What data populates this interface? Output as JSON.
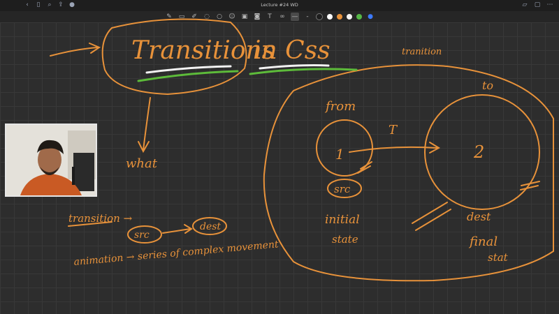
{
  "window": {
    "title": "Lecture #24 WD"
  },
  "toolbar": {
    "tools": [
      "pen-icon",
      "eraser-icon",
      "highlighter-icon",
      "lasso-icon",
      "shapes-icon",
      "sticker-icon",
      "image-icon",
      "camera-icon",
      "text-icon",
      "link-icon",
      "line-width-icon"
    ],
    "colors": [
      "#1e1e1e",
      "#ffffff",
      "#e8923a",
      "#ffffff",
      "#55b846"
    ],
    "accent": "#3d7bff"
  },
  "notes": {
    "heading_1": "Transitions",
    "heading_2": "in Css",
    "top_right": "tranition",
    "what": "what",
    "from": "from",
    "to": "to",
    "T": "T",
    "one": "1",
    "two": "2",
    "src_1": "src",
    "initial": "initial",
    "state": "state",
    "dest": "dest",
    "final": "final",
    "stat": "stat",
    "transition_arrow": "transition →",
    "src_2": "src",
    "dest_2": "dest",
    "animation": "animation → series of complex movement"
  },
  "ink": {
    "orange": "#e8923a",
    "white": "#f2f2f2",
    "green": "#5dbb3a"
  }
}
